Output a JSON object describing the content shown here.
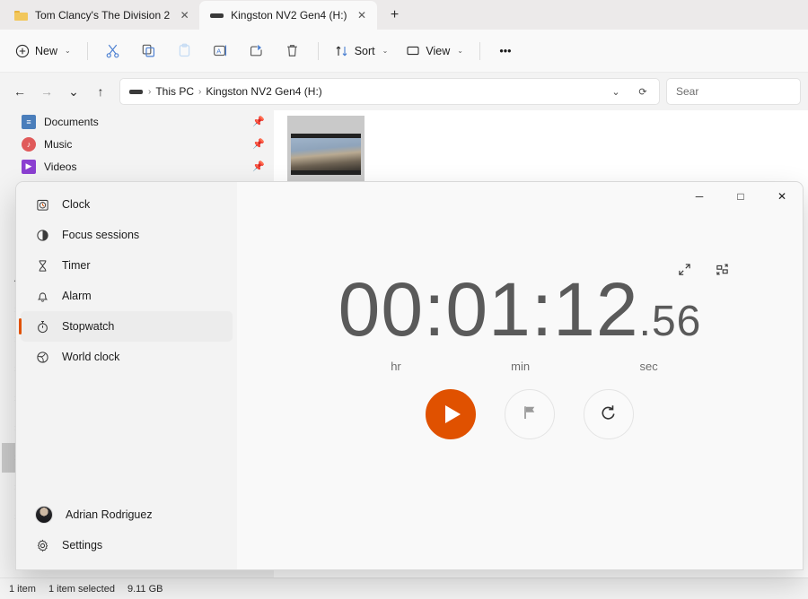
{
  "explorer": {
    "tabs": [
      {
        "title": "Tom Clancy's The Division 2",
        "icon": "folder-icon",
        "close": "✕",
        "active": false
      },
      {
        "title": "Kingston NV2 Gen4 (H:)",
        "icon": "drive-icon",
        "close": "✕",
        "active": true
      }
    ],
    "new_tab_label": "+",
    "toolbar": {
      "new_label": "New",
      "new_icon": "plus-circle-icon",
      "cut_icon": "scissors-icon",
      "copy_icon": "copy-icon",
      "paste_icon": "paste-icon",
      "rename_icon": "rename-icon",
      "share_icon": "share-icon",
      "delete_icon": "trash-icon",
      "sort_label": "Sort",
      "sort_icon": "sort-icon",
      "view_label": "View",
      "view_icon": "monitor-icon",
      "more_label": "•••",
      "chevron": "⌄"
    },
    "nav": {
      "back_icon": "←",
      "forward_icon": "→",
      "recent_icon": "⌄",
      "up_icon": "↑",
      "breadcrumb": [
        "This PC",
        "Kingston NV2 Gen4 (H:)"
      ],
      "breadcrumb_separator": "›",
      "dropdown_icon": "⌄",
      "refresh_icon": "⟳",
      "search_placeholder": "Sear"
    },
    "sidebar": {
      "items": [
        {
          "label": "Documents",
          "icon": "documents-icon",
          "color": "#4a7ebb",
          "glyph": "≡",
          "pin": "📌"
        },
        {
          "label": "Music",
          "icon": "music-icon",
          "color": "#e05a5a",
          "glyph": "♪",
          "pin": "📌"
        },
        {
          "label": "Videos",
          "icon": "videos-icon",
          "color": "#8b3fd1",
          "glyph": "▶",
          "pin": "📌"
        }
      ],
      "tree_chevrons": [
        "⌄",
        "›",
        "›",
        "›",
        "›",
        "›",
        "›",
        "›",
        "›"
      ],
      "selected_chevron_index": 6
    },
    "statusbar": {
      "item_count": "1 item",
      "selection": "1 item selected",
      "size": "9.11 GB"
    }
  },
  "clock": {
    "window_controls": {
      "minimize": "─",
      "maximize": "□",
      "close": "✕"
    },
    "nav_items": [
      {
        "label": "Clock",
        "icon": "clock-icon",
        "selected": false
      },
      {
        "label": "Focus sessions",
        "icon": "focus-sessions-icon",
        "selected": false
      },
      {
        "label": "Timer",
        "icon": "hourglass-icon",
        "selected": false
      },
      {
        "label": "Alarm",
        "icon": "bell-icon",
        "selected": false
      },
      {
        "label": "Stopwatch",
        "icon": "stopwatch-icon",
        "selected": true
      },
      {
        "label": "World clock",
        "icon": "globe-icon",
        "selected": false
      }
    ],
    "account": {
      "name": "Adrian Rodriguez",
      "icon": "avatar"
    },
    "settings": {
      "label": "Settings",
      "icon": "gear-icon"
    },
    "stopwatch": {
      "time_main": "00:01:12",
      "time_fraction": ".56",
      "unit_hr": "hr",
      "unit_min": "min",
      "unit_sec": "sec",
      "expand_icon": "expand-icon",
      "compact_icon": "compact-overlay-icon",
      "play_button": "play-button",
      "lap_button": "flag-lap-button",
      "reset_button": "reset-button",
      "accent_color": "#e05100"
    }
  }
}
